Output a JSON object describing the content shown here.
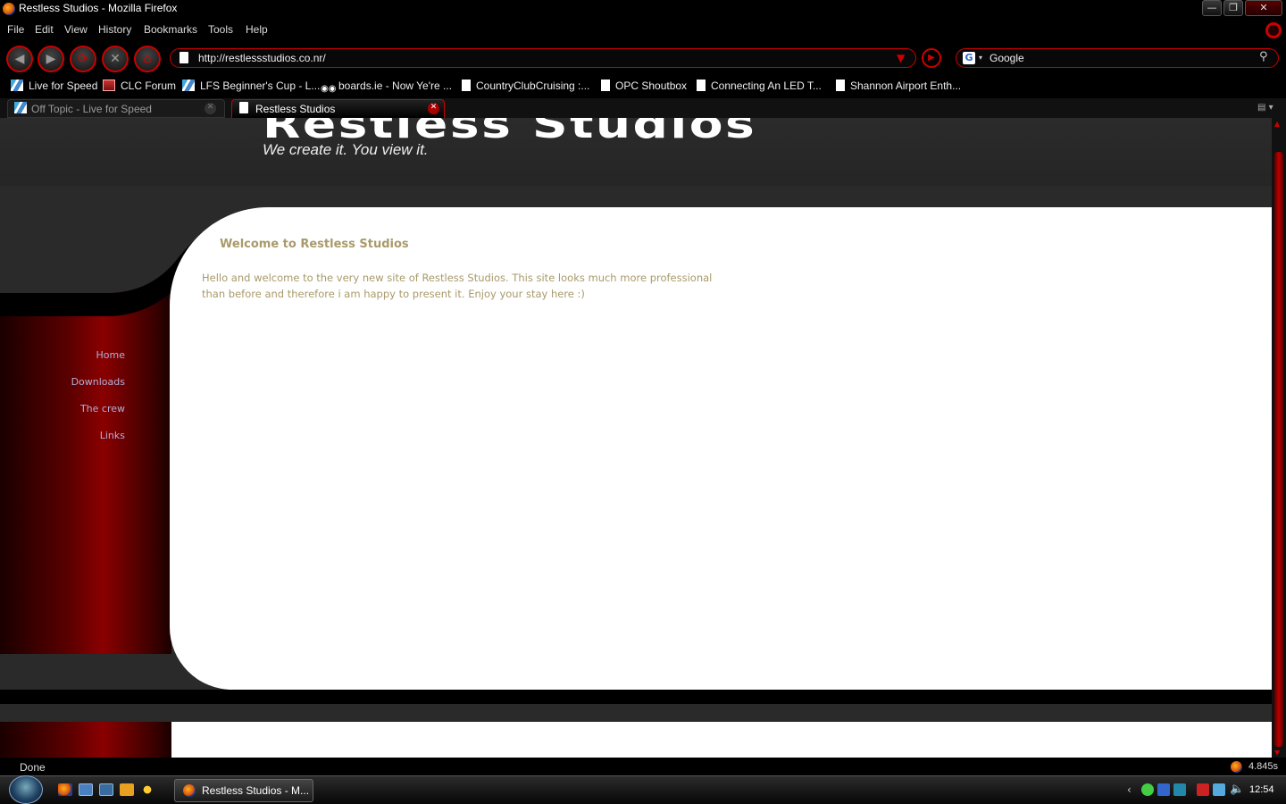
{
  "window": {
    "title": "Restless Studios - Mozilla Firefox",
    "controls": {
      "minimize": "—",
      "maximize": "❐",
      "close": "✕"
    }
  },
  "menu": [
    "File",
    "Edit",
    "View",
    "History",
    "Bookmarks",
    "Tools",
    "Help"
  ],
  "nav": {
    "url": "http://restlessstudios.co.nr/",
    "search_engine": "Google",
    "search_engine_icon_letter": "G"
  },
  "bookmarks": [
    {
      "label": "Live for Speed",
      "icon": "lfs-icon"
    },
    {
      "label": "CLC Forum",
      "icon": "clc-icon"
    },
    {
      "label": "LFS Beginner's Cup - L...",
      "icon": "lfs-icon"
    },
    {
      "label": "boards.ie - Now Ye're ...",
      "icon": "boards-icon"
    },
    {
      "label": "CountryClubCruising :...",
      "icon": "page-icon"
    },
    {
      "label": "OPC Shoutbox",
      "icon": "page-icon"
    },
    {
      "label": "Connecting An LED T...",
      "icon": "page-icon"
    },
    {
      "label": "Shannon Airport Enth...",
      "icon": "page-icon"
    }
  ],
  "tabs": [
    {
      "label": "Off Topic - Live for Speed",
      "active": false
    },
    {
      "label": "Restless Studios",
      "active": true
    }
  ],
  "site": {
    "logo_text": "Restless Studios",
    "tagline": "We create it. You view it.",
    "welcome_heading": "Welcome to Restless Studios",
    "welcome_body": "Hello and welcome to the very new site of Restless Studios. This site looks much more professional than before and therefore i am happy to present it. Enjoy your stay here :)",
    "nav_links": [
      "Home",
      "Downloads",
      "The crew",
      "Links"
    ]
  },
  "status": {
    "text": "Done",
    "timer": "4.845s"
  },
  "taskbar": {
    "task_label": "Restless Studios - M...",
    "clock": "12:54"
  },
  "colors": {
    "accent_red": "#cc0000",
    "text_tan": "#a89a6a",
    "nav_link": "#b0b0d8"
  }
}
